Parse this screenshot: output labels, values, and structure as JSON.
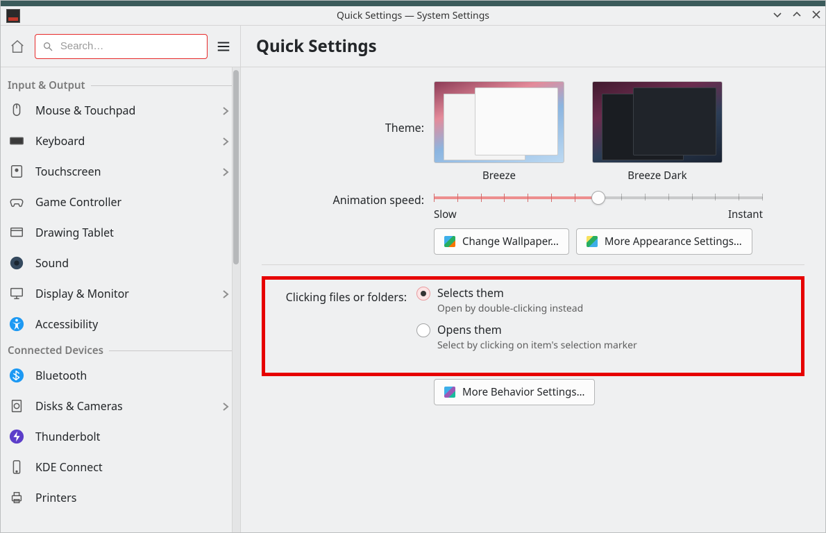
{
  "window": {
    "title": "Quick Settings — System Settings"
  },
  "search": {
    "placeholder": "Search…"
  },
  "page": {
    "heading": "Quick Settings"
  },
  "sidebar": {
    "sections": [
      {
        "title": "Input & Output",
        "items": [
          {
            "label": "Mouse & Touchpad",
            "icon": "mouse",
            "chevron": true
          },
          {
            "label": "Keyboard",
            "icon": "keyboard",
            "chevron": true
          },
          {
            "label": "Touchscreen",
            "icon": "touchscreen",
            "chevron": true
          },
          {
            "label": "Game Controller",
            "icon": "gamepad",
            "chevron": false
          },
          {
            "label": "Drawing Tablet",
            "icon": "tablet",
            "chevron": false
          },
          {
            "label": "Sound",
            "icon": "sound",
            "chevron": false
          },
          {
            "label": "Display & Monitor",
            "icon": "monitor",
            "chevron": true
          },
          {
            "label": "Accessibility",
            "icon": "accessibility",
            "chevron": false
          }
        ]
      },
      {
        "title": "Connected Devices",
        "items": [
          {
            "label": "Bluetooth",
            "icon": "bluetooth",
            "chevron": false
          },
          {
            "label": "Disks & Cameras",
            "icon": "disk",
            "chevron": true
          },
          {
            "label": "Thunderbolt",
            "icon": "thunderbolt",
            "chevron": false
          },
          {
            "label": "KDE Connect",
            "icon": "phone",
            "chevron": false
          },
          {
            "label": "Printers",
            "icon": "printer",
            "chevron": false
          }
        ]
      }
    ]
  },
  "labels": {
    "theme": "Theme:",
    "animation_speed": "Animation speed:",
    "slow": "Slow",
    "instant": "Instant",
    "clicking": "Clicking files or folders:"
  },
  "themes": [
    {
      "name": "Breeze",
      "variant": "light"
    },
    {
      "name": "Breeze Dark",
      "variant": "dark"
    }
  ],
  "animation": {
    "value_pct": 50
  },
  "buttons": {
    "change_wallpaper": "Change Wallpaper…",
    "more_appearance": "More Appearance Settings…",
    "more_behavior": "More Behavior Settings…"
  },
  "click_options": [
    {
      "label": "Selects them",
      "sub": "Open by double-clicking instead",
      "selected": true
    },
    {
      "label": "Opens them",
      "sub": "Select by clicking on item's selection marker",
      "selected": false
    }
  ]
}
